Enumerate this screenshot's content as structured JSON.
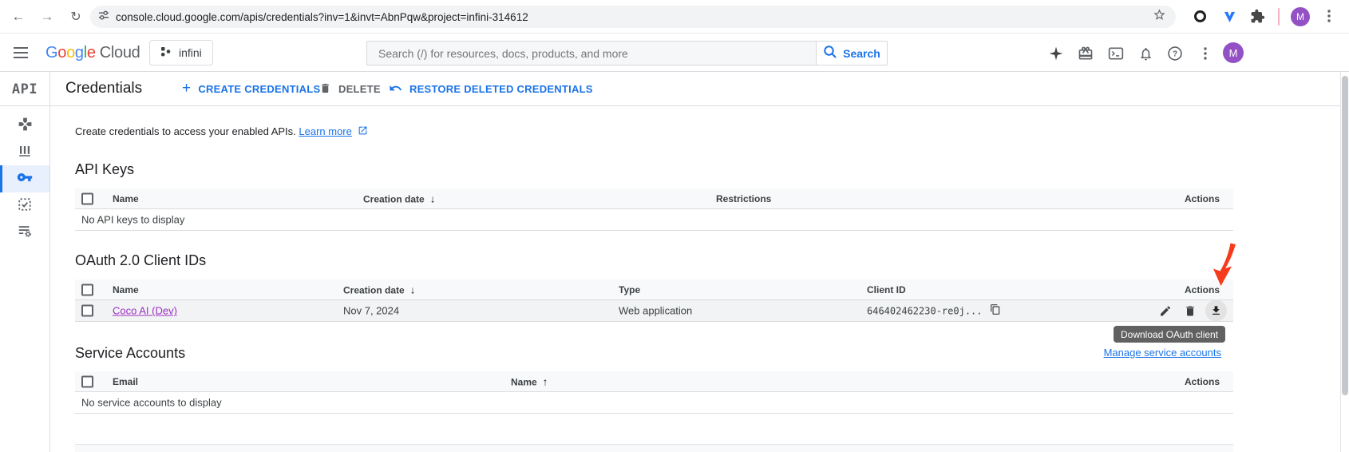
{
  "colors": {
    "accent": "#1a73e8",
    "visited_link": "#9d2fc4",
    "arrow": "#f63b1c",
    "tooltip_bg": "#616161",
    "avatar_bg": "#9351c5"
  },
  "browser": {
    "url": "console.cloud.google.com/apis/credentials?inv=1&invt=AbnPqw&project=infini-314612",
    "avatar_initial": "M"
  },
  "gcp_header": {
    "logo_letters": [
      "G",
      "o",
      "o",
      "g",
      "l",
      "e"
    ],
    "logo_cloud": "Cloud",
    "project_name": "infini",
    "search_placeholder": "Search (/) for resources, docs, products, and more",
    "search_button": "Search",
    "avatar_initial": "M"
  },
  "api_nav": {
    "logo": "API"
  },
  "page": {
    "title": "Credentials",
    "create_label": "CREATE CREDENTIALS",
    "delete_label": "DELETE",
    "restore_label": "RESTORE DELETED CREDENTIALS",
    "intro": "Create credentials to access your enabled APIs.",
    "learn_more": "Learn more"
  },
  "api_keys": {
    "title": "API Keys",
    "col_name": "Name",
    "col_creation": "Creation date",
    "sort_down": "↓",
    "col_restrictions": "Restrictions",
    "col_actions": "Actions",
    "empty": "No API keys to display"
  },
  "oauth": {
    "title": "OAuth 2.0 Client IDs",
    "col_name": "Name",
    "col_creation": "Creation date",
    "sort_down": "↓",
    "col_type": "Type",
    "col_client_id": "Client ID",
    "col_actions": "Actions",
    "row": {
      "name": "Coco AI (Dev)",
      "created": "Nov 7, 2024",
      "type": "Web application",
      "client_id": "646402462230-re0j..."
    }
  },
  "tooltip": {
    "text": "Download OAuth client"
  },
  "service_accounts": {
    "title": "Service Accounts",
    "manage_link": "Manage service accounts",
    "col_email": "Email",
    "col_name": "Name",
    "sort_up": "↑",
    "col_actions": "Actions",
    "empty": "No service accounts to display"
  }
}
